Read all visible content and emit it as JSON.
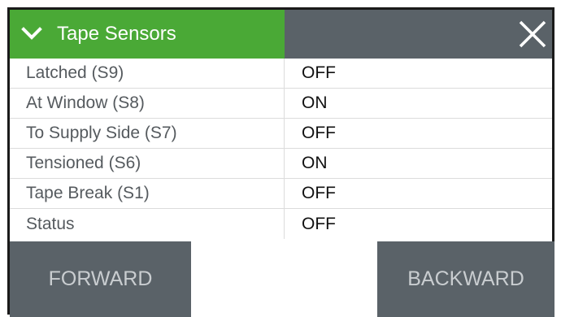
{
  "header": {
    "title": "Tape Sensors",
    "accent_color": "#4aa936",
    "panel_color": "#5a6268",
    "expand_icon": "chevron-down-icon",
    "close_icon": "close-icon"
  },
  "sensors": [
    {
      "label": "Latched (S9)",
      "value": "OFF"
    },
    {
      "label": "At Window (S8)",
      "value": "ON"
    },
    {
      "label": "To Supply Side (S7)",
      "value": "OFF"
    },
    {
      "label": "Tensioned (S6)",
      "value": "ON"
    },
    {
      "label": "Tape Break (S1)",
      "value": "OFF"
    },
    {
      "label": "Status",
      "value": "OFF"
    }
  ],
  "buttons": {
    "forward_label": "FORWARD",
    "backward_label": "BACKWARD"
  }
}
